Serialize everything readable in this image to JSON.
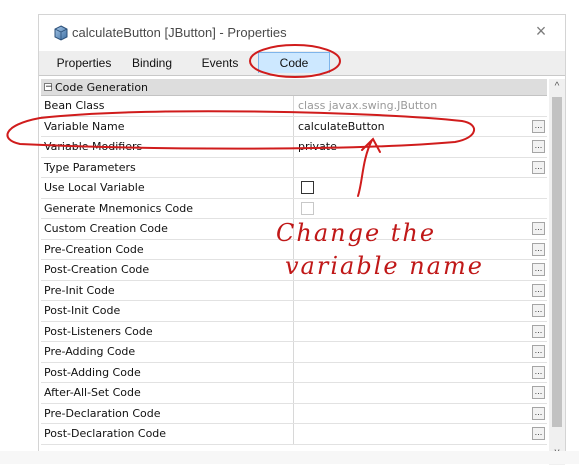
{
  "window": {
    "title": "calculateButton [JButton] - Properties",
    "close_icon": "×"
  },
  "tabs": [
    {
      "label": "Properties",
      "active": false
    },
    {
      "label": "Binding",
      "active": false
    },
    {
      "label": "Events",
      "active": false
    },
    {
      "label": "Code",
      "active": true
    }
  ],
  "category": {
    "toggle": "−",
    "label": "Code Generation"
  },
  "properties": [
    {
      "name": "Bean Class",
      "value": "class javax.swing.JButton"
    },
    {
      "name": "Variable Name",
      "value": "calculateButton",
      "button": "..."
    },
    {
      "name": "Variable Modifiers",
      "value": "private",
      "button": "..."
    },
    {
      "name": "Type Parameters",
      "value": "",
      "button": "..."
    },
    {
      "name": "Use Local Variable",
      "value": ""
    },
    {
      "name": "Generate Mnemonics Code",
      "value": ""
    },
    {
      "name": "Custom Creation Code",
      "value": "",
      "button": "..."
    },
    {
      "name": "Pre-Creation Code",
      "value": "",
      "button": "..."
    },
    {
      "name": "Post-Creation Code",
      "value": "",
      "button": "..."
    },
    {
      "name": "Pre-Init Code",
      "value": "",
      "button": "..."
    },
    {
      "name": "Post-Init Code",
      "value": "",
      "button": "..."
    },
    {
      "name": "Post-Listeners Code",
      "value": "",
      "button": "..."
    },
    {
      "name": "Pre-Adding Code",
      "value": "",
      "button": "..."
    },
    {
      "name": "Post-Adding Code",
      "value": "",
      "button": "..."
    },
    {
      "name": "After-All-Set Code",
      "value": "",
      "button": "..."
    },
    {
      "name": "Pre-Declaration Code",
      "value": "",
      "button": "..."
    },
    {
      "name": "Post-Declaration Code",
      "value": "",
      "button": "..."
    }
  ],
  "scrollbar": {
    "up": "^",
    "down": "v"
  },
  "annotation": {
    "line1": "Change the",
    "line2": "variable name",
    "color": "#c01818"
  }
}
